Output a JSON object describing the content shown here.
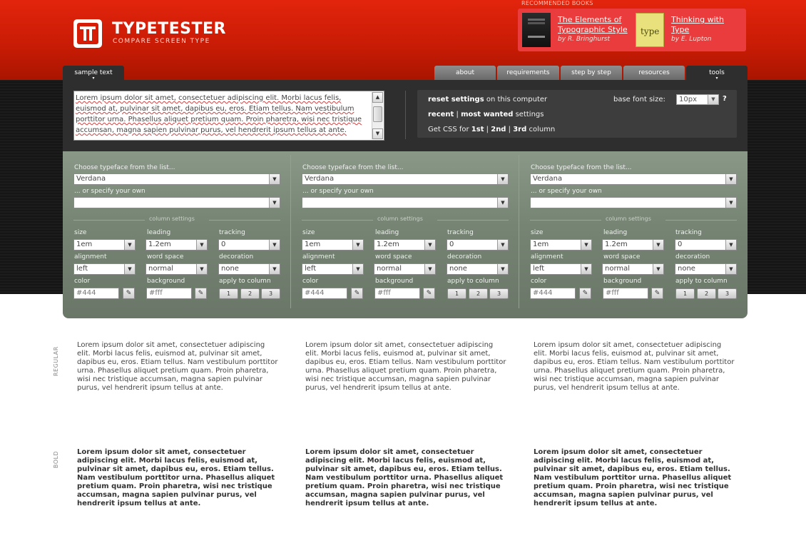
{
  "header": {
    "brand": "TYPETESTER",
    "tagline": "COMPARE SCREEN TYPE",
    "recommended_label": "RECOMMENDED BOOKS",
    "books": [
      {
        "title_line1": "The Elements of",
        "title_line2": "Typographic Style",
        "author": "by R. Bringhurst",
        "cover_text": ""
      },
      {
        "title_line1": "Thinking with",
        "title_line2": "Type",
        "author": "by E. Lupton",
        "cover_text": "type"
      }
    ]
  },
  "tabs": {
    "sample_text": "sample text",
    "about": "about",
    "requirements": "requirements",
    "step_by_step": "step by step",
    "resources": "resources",
    "tools": "tools"
  },
  "sample": {
    "text": "Lorem ipsum dolor sit amet, consectetuer adipiscing elit. Morbi lacus felis, euismod at, pulvinar sit amet, dapibus eu, eros. Etiam tellus. Nam vestibulum porttitor urna. Phasellus aliquet pretium quam. Proin pharetra, wisi nec tristique accumsan, magna sapien pulvinar purus, vel hendrerit ipsum tellus at ante."
  },
  "settings": {
    "reset_bold": "reset settings",
    "reset_rest": " on this computer",
    "recent": "recent",
    "sep": " | ",
    "most_wanted": "most wanted",
    "settings_word": " settings",
    "css_prefix": "Get CSS for ",
    "col1": "1st",
    "col2": "2nd",
    "col3": "3rd",
    "css_suffix": " column",
    "base_font_label": "base font size:",
    "base_font_value": "10px",
    "help": "?"
  },
  "column_labels": {
    "choose": "Choose typeface from the list...",
    "specify": "... or specify your own",
    "column_settings": "column settings",
    "size": "size",
    "leading": "leading",
    "tracking": "tracking",
    "alignment": "alignment",
    "word_space": "word space",
    "decoration": "decoration",
    "color": "color",
    "background": "background",
    "apply": "apply to column",
    "btn1": "1",
    "btn2": "2",
    "btn3": "3"
  },
  "columns": [
    {
      "typeface": "Verdana",
      "custom": "",
      "size": "1em",
      "leading": "1.2em",
      "tracking": "0",
      "alignment": "left",
      "word_space": "normal",
      "decoration": "none",
      "color": "#444",
      "background": "#fff"
    },
    {
      "typeface": "Verdana",
      "custom": "",
      "size": "1em",
      "leading": "1.2em",
      "tracking": "0",
      "alignment": "left",
      "word_space": "normal",
      "decoration": "none",
      "color": "#444",
      "background": "#fff"
    },
    {
      "typeface": "Verdana",
      "custom": "",
      "size": "1em",
      "leading": "1.2em",
      "tracking": "0",
      "alignment": "left",
      "word_space": "normal",
      "decoration": "none",
      "color": "#444",
      "background": "#fff"
    }
  ],
  "preview": {
    "regular_label": "REGULAR",
    "bold_label": "BOLD",
    "text": "Lorem ipsum dolor sit amet, consectetuer adipiscing elit. Morbi lacus felis, euismod at, pulvinar sit amet, dapibus eu, eros. Etiam tellus. Nam vestibulum porttitor urna. Phasellus aliquet pretium quam. Proin pharetra, wisi nec tristique accumsan, magna sapien pulvinar purus, vel hendrerit ipsum tellus at ante."
  },
  "colors": {
    "header_red": "#c71b05",
    "panel_green": "#768474",
    "panel_dark": "#2e2e2e"
  }
}
